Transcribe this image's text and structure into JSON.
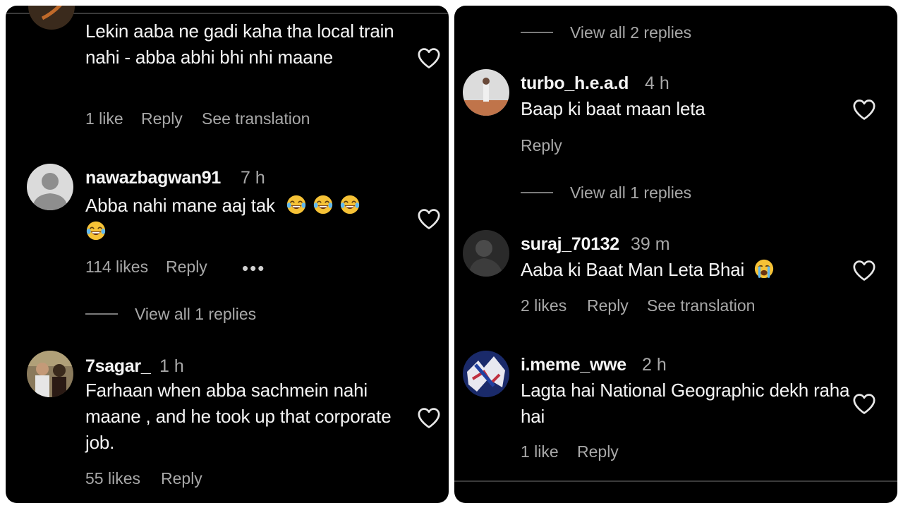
{
  "left_panel": {
    "comments": [
      {
        "text": "Lekin aaba ne gadi kaha tha local train nahi - abba abhi bhi nhi maane",
        "likes": "1 like",
        "reply": "Reply",
        "translate": "See translation"
      },
      {
        "username": "nawazbagwan91",
        "time": "7 h",
        "text": "Abba nahi mane aaj tak",
        "emoji": "laughing-with-tears",
        "likes": "114 likes",
        "reply": "Reply",
        "more": "•••",
        "view_replies": "View all 1 replies"
      },
      {
        "username": "7sagar_",
        "time": "1 h",
        "text": "Farhaan when abba sachmein nahi maane , and he took up that corporate job.",
        "likes": "55 likes",
        "reply": "Reply"
      }
    ]
  },
  "right_panel": {
    "top_view_replies": "View all 2 replies",
    "comments": [
      {
        "username": "turbo_h.e.a.d",
        "time": "4 h",
        "text": "Baap ki baat maan leta",
        "reply": "Reply",
        "view_replies": "View all 1 replies"
      },
      {
        "username": "suraj_70132",
        "time": "39 m",
        "text": "Aaba ki Baat Man Leta Bhai",
        "emoji": "crying",
        "likes": "2 likes",
        "reply": "Reply",
        "translate": "See translation"
      },
      {
        "username": "i.meme_wwe",
        "time": "2 h",
        "text": "Lagta hai National Geographic dekh raha hai",
        "likes": "1 like",
        "reply": "Reply"
      }
    ]
  },
  "colors": {
    "background": "#000000",
    "text_primary": "#f5f5f5",
    "text_secondary": "#a8a8a8",
    "emoji_face": "#f6c236"
  },
  "icons": {
    "like": "heart-outline-icon",
    "more": "more-options-icon"
  }
}
